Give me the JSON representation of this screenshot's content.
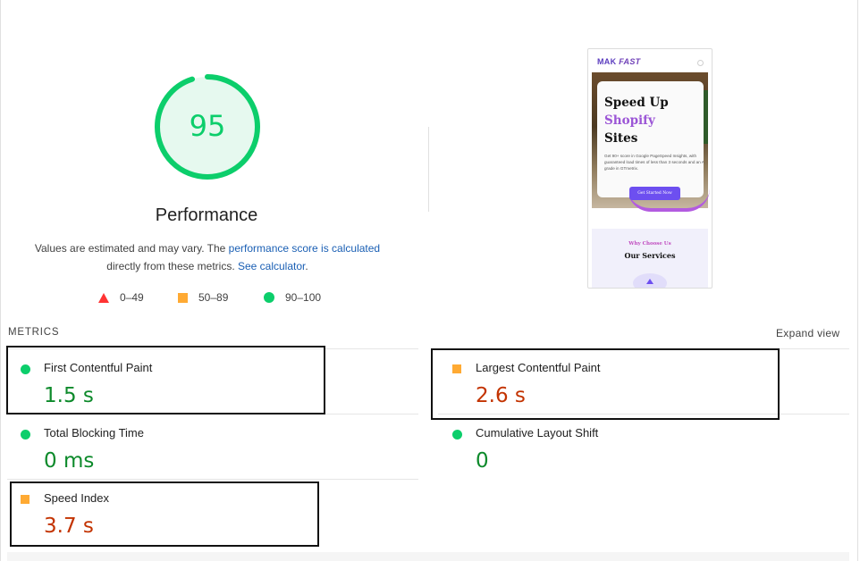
{
  "score": {
    "value": "95",
    "title": "Performance"
  },
  "description": {
    "text1": "Values are estimated and may vary. The ",
    "link1": "performance score is calculated",
    "text2": "directly from these metrics. ",
    "link2": "See calculator",
    "text3": "."
  },
  "legend": {
    "poor": "0–49",
    "average": "50–89",
    "good": "90–100"
  },
  "preview": {
    "logo_a": "MAK",
    "logo_b": "FAST",
    "hero_line1": "Speed Up",
    "hero_line2": "Shopify",
    "hero_line3": "Sites",
    "hero_sub": "Get 90+ score in Google PageSpeed Insights, with guaranteed load times of less than 3 seconds and an A grade in GTmetrix.",
    "cta": "Get Started Now",
    "services_kicker": "Why Choose Us",
    "services_title": "Our Services"
  },
  "metrics": {
    "section_title": "METRICS",
    "expand_label": "Expand view",
    "fcp": {
      "label": "First Contentful Paint",
      "value": "1.5 s",
      "status": "good"
    },
    "lcp": {
      "label": "Largest Contentful Paint",
      "value": "2.6 s",
      "status": "average"
    },
    "tbt": {
      "label": "Total Blocking Time",
      "value": "0 ms",
      "status": "good"
    },
    "cls": {
      "label": "Cumulative Layout Shift",
      "value": "0",
      "status": "good"
    },
    "si": {
      "label": "Speed Index",
      "value": "3.7 s",
      "status": "average"
    }
  },
  "colors": {
    "good": "#0cce6b",
    "average": "#ffaa33",
    "poor": "#ff3333"
  },
  "gauge_fraction": 0.95
}
